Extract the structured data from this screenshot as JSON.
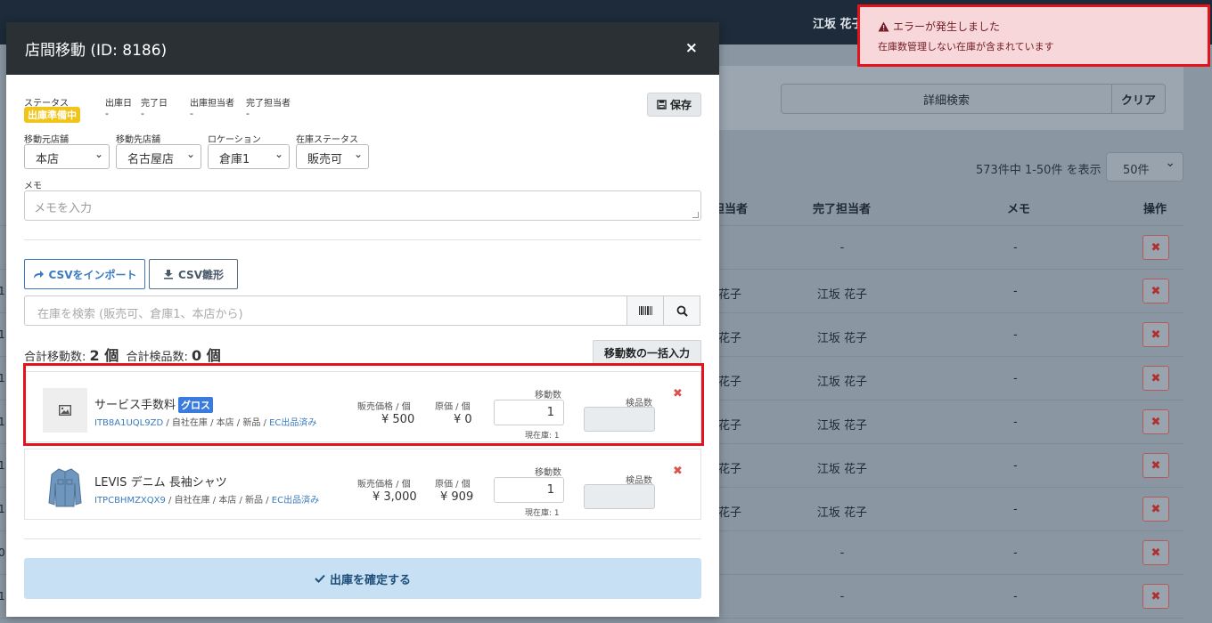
{
  "app": {
    "user_name": "江坂 花子",
    "search_detail_label": "詳細検索",
    "clear_label": "クリア",
    "result_count": "573件中 1-50件 を表示",
    "per_page": "50件",
    "table_headers": {
      "staff": "担当者",
      "done_staff": "完了担当者",
      "memo": "メモ",
      "action": "操作"
    },
    "rows": [
      {
        "left": "",
        "staff": "",
        "done_staff": "-",
        "memo": "-"
      },
      {
        "left": "1",
        "staff": "花子",
        "done_staff": "江坂 花子",
        "memo": "-"
      },
      {
        "left": "1",
        "staff": "花子",
        "done_staff": "江坂 花子",
        "memo": "-"
      },
      {
        "left": "1",
        "staff": "花子",
        "done_staff": "江坂 花子",
        "memo": "-"
      },
      {
        "left": "1",
        "staff": "花子",
        "done_staff": "江坂 花子",
        "memo": "-"
      },
      {
        "left": "1",
        "staff": "花子",
        "done_staff": "江坂 花子",
        "memo": "-"
      },
      {
        "left": "1",
        "staff": "花子",
        "done_staff": "江坂 花子",
        "memo": "-"
      },
      {
        "left": "0",
        "staff": "",
        "done_staff": "-",
        "memo": "-"
      },
      {
        "left": "1",
        "staff": "",
        "done_staff": "-",
        "memo": "-"
      }
    ],
    "delete_glyph": "✖"
  },
  "toast": {
    "title": "エラーが発生しました",
    "message": "在庫数管理しない在庫が含まれています"
  },
  "modal": {
    "title": "店間移動 (ID: 8186)",
    "close_glyph": "×",
    "save_label": "保存",
    "status_label": "ステータス",
    "status_value": "出庫準備中",
    "ship_date_label": "出庫日",
    "ship_date_value": "-",
    "done_date_label": "完了日",
    "done_date_value": "-",
    "ship_staff_label": "出庫担当者",
    "ship_staff_value": "-",
    "done_staff_label": "完了担当者",
    "done_staff_value": "-",
    "from_store_label": "移動元店舗",
    "from_store_value": "本店",
    "to_store_label": "移動先店舗",
    "to_store_value": "名古屋店",
    "location_label": "ロケーション",
    "location_value": "倉庫1",
    "stock_status_label": "在庫ステータス",
    "stock_status_value": "販売可",
    "memo_label": "メモ",
    "memo_placeholder": "メモを入力",
    "csv_import_label": "CSVをインポート",
    "csv_template_label": "CSV雛形",
    "search_placeholder": "在庫を検索 (販売可、倉庫1、本店から)",
    "total_move_label": "合計移動数:",
    "total_move_value": "2 個",
    "total_inspect_label": "合計検品数:",
    "total_inspect_value": "0 個",
    "bulk_input_label": "移動数の一括入力",
    "confirm_label": "出庫を確定する"
  },
  "items": [
    {
      "name": "サービス手数料",
      "badge": "グロス",
      "sku": "ITB8A1UQL9ZD",
      "meta": " / 自社在庫 / 本店 / 新品 / ",
      "ec": "EC出品済み",
      "price_label": "販売価格 / 個",
      "price": "¥ 500",
      "cost_label": "原価 / 個",
      "cost": "¥ 0",
      "qty_label": "移動数",
      "qty": "1",
      "stock": "現在庫: 1",
      "inspect_label": "検品数",
      "image_icon": "image-placeholder-icon"
    },
    {
      "name": "LEVIS デニム 長袖シャツ",
      "badge": "",
      "sku": "ITPCBHMZXQX9",
      "meta": " / 自社在庫 / 本店 / 新品 / ",
      "ec": "EC出品済み",
      "price_label": "販売価格 / 個",
      "price": "¥ 3,000",
      "cost_label": "原価 / 個",
      "cost": "¥ 909",
      "qty_label": "移動数",
      "qty": "1",
      "stock": "現在庫: 1",
      "inspect_label": "検品数",
      "image_icon": "denim-shirt-icon"
    }
  ],
  "colors": {
    "status_badge": "#f0c419",
    "gross_badge": "#3a7bdf",
    "link": "#3a7bbf",
    "error_border": "#e0141a",
    "toast_bg": "#f8d7da",
    "confirm_bg": "#c7e0f4"
  }
}
